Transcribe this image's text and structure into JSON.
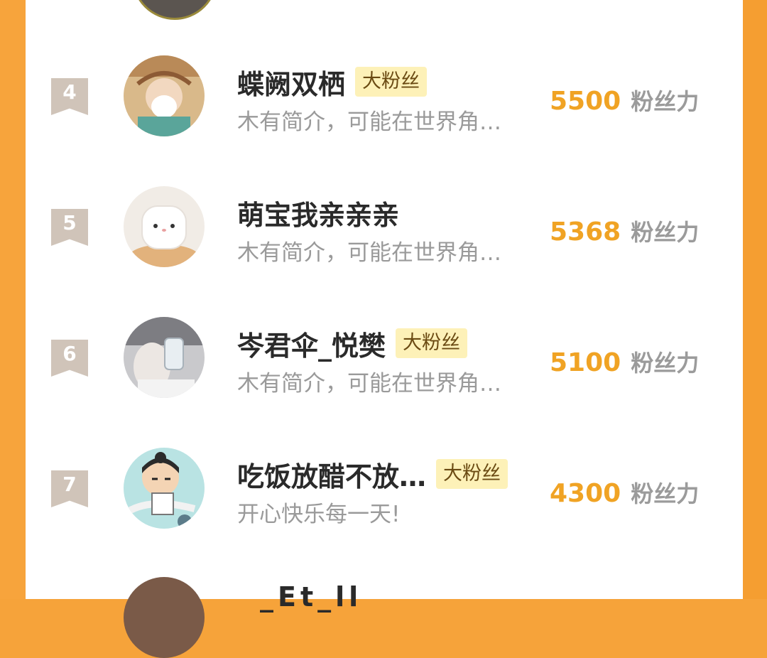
{
  "leaderboard": {
    "rows": [
      {
        "rank": "4",
        "name": "蝶阙双栖",
        "badge": "大粉丝",
        "bio": "木有简介，可能在世界角…",
        "score": "5500",
        "score_label": "粉丝力"
      },
      {
        "rank": "5",
        "name": "萌宝我亲亲亲",
        "badge": "",
        "bio": "木有简介，可能在世界角…",
        "score": "5368",
        "score_label": "粉丝力"
      },
      {
        "rank": "6",
        "name": "岑君伞_悦樊",
        "badge": "大粉丝",
        "bio": "木有简介，可能在世界角…",
        "score": "5100",
        "score_label": "粉丝力"
      },
      {
        "rank": "7",
        "name": "吃饭放醋不放…",
        "badge": "大粉丝",
        "bio": "开心快乐每一天!",
        "score": "4300",
        "score_label": "粉丝力"
      }
    ],
    "next_row_partial_name": "_Et_ll"
  },
  "colors": {
    "frame": "#f6a33a",
    "rank_badge": "#d0c4b9",
    "score": "#f0a324",
    "badge_bg": "#fdf1b8"
  }
}
